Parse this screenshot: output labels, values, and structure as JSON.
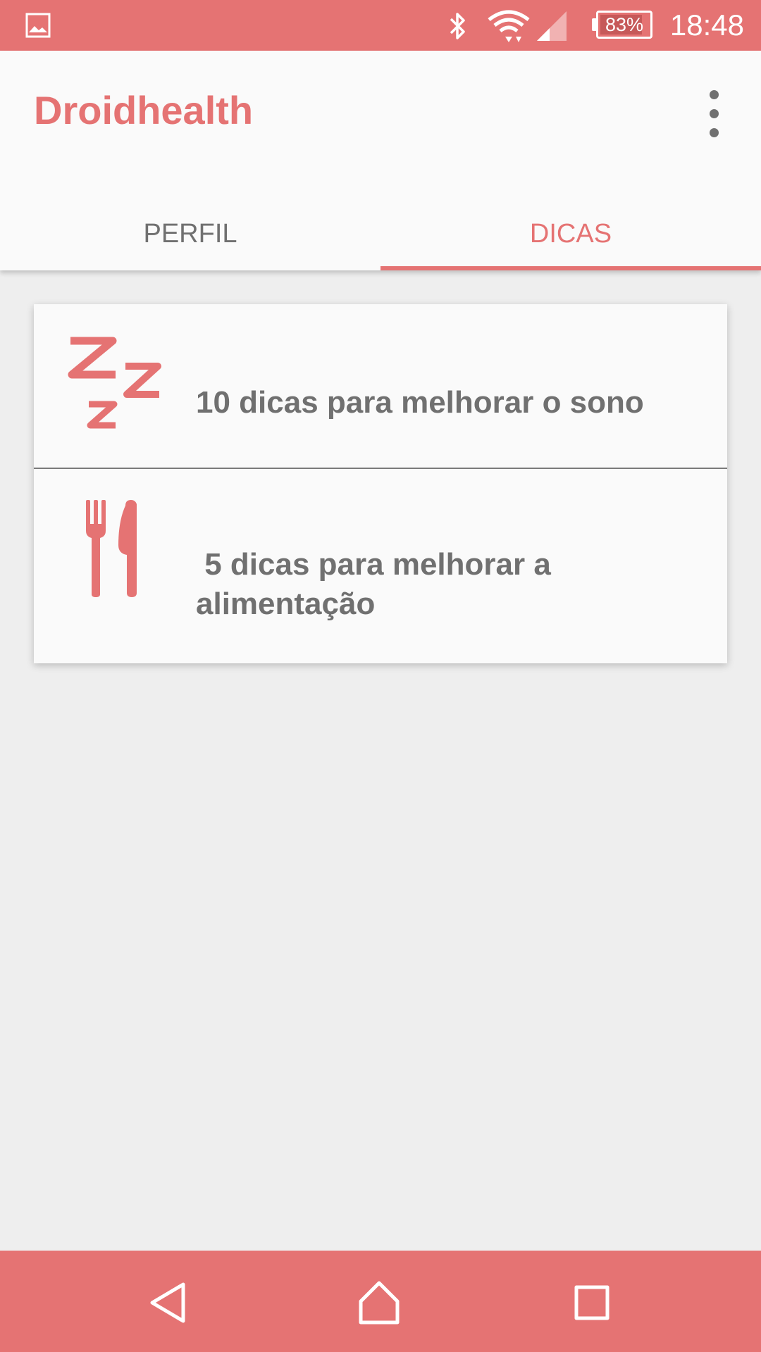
{
  "status_bar": {
    "time": "18:48",
    "battery": "83%",
    "battery_level": 0.83,
    "icons": [
      "image-notification-icon",
      "bluetooth-icon",
      "wifi-icon",
      "cell-signal-icon",
      "battery-icon"
    ]
  },
  "app_bar": {
    "title": "Droidhealth",
    "menu_icon": "more-vertical-icon"
  },
  "tabs": [
    {
      "label": "PERFIL",
      "active": false
    },
    {
      "label": "DICAS",
      "active": true
    }
  ],
  "tips": [
    {
      "icon": "sleep-zzz-icon",
      "label": "10 dicas para melhorar o sono"
    },
    {
      "icon": "fork-knife-icon",
      "label": " 5 dicas para melhorar a alimentação"
    }
  ],
  "nav_bar": {
    "buttons": [
      "back-icon",
      "home-icon",
      "recent-apps-icon"
    ]
  },
  "colors": {
    "accent": "#e57373",
    "text": "#707070",
    "background": "#eeeeee",
    "surface": "#fafafa"
  }
}
